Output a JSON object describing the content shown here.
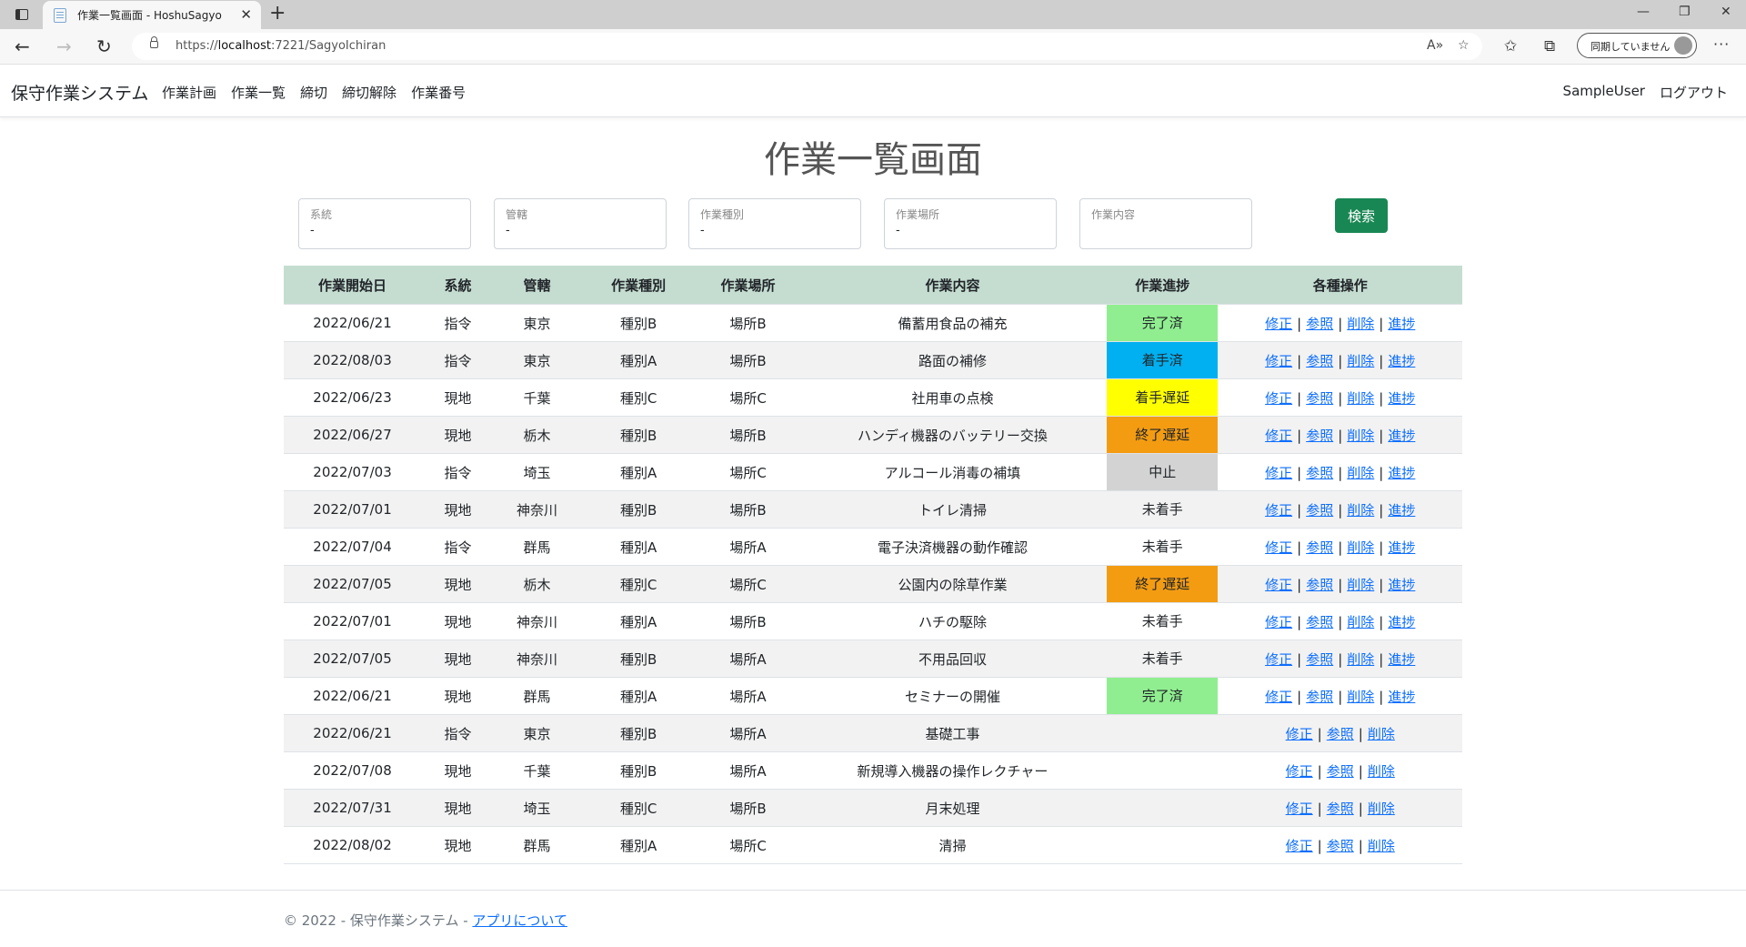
{
  "browser": {
    "tab_title": "作業一覧画面 - HoshuSagyo",
    "url_prefix": "https://",
    "url_host": "localhost",
    "url_rest": ":7221/SagyoIchiran",
    "sync_label": "同期していません"
  },
  "navbar": {
    "brand": "保守作業システム",
    "links": [
      "作業計画",
      "作業一覧",
      "締切",
      "締切解除",
      "作業番号"
    ],
    "user": "SampleUser",
    "logout": "ログアウト"
  },
  "page": {
    "title": "作業一覧画面",
    "filters": [
      {
        "label": "系統",
        "value": "-"
      },
      {
        "label": "管轄",
        "value": "-"
      },
      {
        "label": "作業種別",
        "value": "-"
      },
      {
        "label": "作業場所",
        "value": "-"
      },
      {
        "label": "作業内容",
        "value": ""
      }
    ],
    "search_button": "検索"
  },
  "table": {
    "headers": [
      "作業開始日",
      "系統",
      "管轄",
      "作業種別",
      "作業場所",
      "作業内容",
      "作業進捗",
      "各種操作"
    ],
    "status_colors": {
      "完了済": "#90ee90",
      "着手済": "#00b0f0",
      "着手遅延": "#ffff00",
      "終了遅延": "#f39c12",
      "中止": "#d3d3d3"
    },
    "op_labels": {
      "edit": "修正",
      "view": "参照",
      "delete": "削除",
      "progress": "進捗"
    },
    "separator": "|",
    "rows": [
      {
        "date": "2022/06/21",
        "system": "指令",
        "area": "東京",
        "kind": "種別B",
        "place": "場所B",
        "content": "備蓄用食品の補充",
        "status": "完了済",
        "has_progress": true
      },
      {
        "date": "2022/08/03",
        "system": "指令",
        "area": "東京",
        "kind": "種別A",
        "place": "場所B",
        "content": "路面の補修",
        "status": "着手済",
        "has_progress": true
      },
      {
        "date": "2022/06/23",
        "system": "現地",
        "area": "千葉",
        "kind": "種別C",
        "place": "場所C",
        "content": "社用車の点検",
        "status": "着手遅延",
        "has_progress": true
      },
      {
        "date": "2022/06/27",
        "system": "現地",
        "area": "栃木",
        "kind": "種別B",
        "place": "場所B",
        "content": "ハンディ機器のバッテリー交換",
        "status": "終了遅延",
        "has_progress": true
      },
      {
        "date": "2022/07/03",
        "system": "指令",
        "area": "埼玉",
        "kind": "種別A",
        "place": "場所C",
        "content": "アルコール消毒の補填",
        "status": "中止",
        "has_progress": true
      },
      {
        "date": "2022/07/01",
        "system": "現地",
        "area": "神奈川",
        "kind": "種別B",
        "place": "場所B",
        "content": "トイレ清掃",
        "status": "未着手",
        "has_progress": true
      },
      {
        "date": "2022/07/04",
        "system": "指令",
        "area": "群馬",
        "kind": "種別A",
        "place": "場所A",
        "content": "電子決済機器の動作確認",
        "status": "未着手",
        "has_progress": true
      },
      {
        "date": "2022/07/05",
        "system": "現地",
        "area": "栃木",
        "kind": "種別C",
        "place": "場所C",
        "content": "公園内の除草作業",
        "status": "終了遅延",
        "has_progress": true
      },
      {
        "date": "2022/07/01",
        "system": "現地",
        "area": "神奈川",
        "kind": "種別A",
        "place": "場所B",
        "content": "ハチの駆除",
        "status": "未着手",
        "has_progress": true
      },
      {
        "date": "2022/07/05",
        "system": "現地",
        "area": "神奈川",
        "kind": "種別B",
        "place": "場所A",
        "content": "不用品回収",
        "status": "未着手",
        "has_progress": true
      },
      {
        "date": "2022/06/21",
        "system": "現地",
        "area": "群馬",
        "kind": "種別A",
        "place": "場所A",
        "content": "セミナーの開催",
        "status": "完了済",
        "has_progress": true
      },
      {
        "date": "2022/06/21",
        "system": "指令",
        "area": "東京",
        "kind": "種別B",
        "place": "場所A",
        "content": "基礎工事",
        "status": "",
        "has_progress": false
      },
      {
        "date": "2022/07/08",
        "system": "現地",
        "area": "千葉",
        "kind": "種別B",
        "place": "場所A",
        "content": "新規導入機器の操作レクチャー",
        "status": "",
        "has_progress": false
      },
      {
        "date": "2022/07/31",
        "system": "現地",
        "area": "埼玉",
        "kind": "種別C",
        "place": "場所B",
        "content": "月末処理",
        "status": "",
        "has_progress": false
      },
      {
        "date": "2022/08/02",
        "system": "現地",
        "area": "群馬",
        "kind": "種別A",
        "place": "場所C",
        "content": "清掃",
        "status": "",
        "has_progress": false
      }
    ]
  },
  "footer": {
    "text": "© 2022 - 保守作業システム - ",
    "link": "アプリについて"
  }
}
